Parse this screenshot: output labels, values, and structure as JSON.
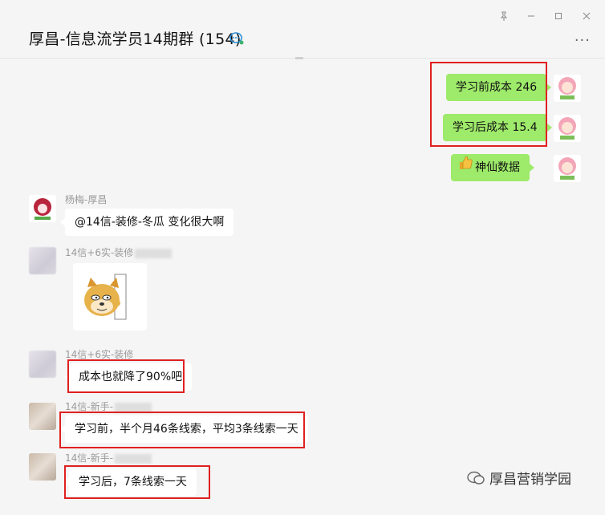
{
  "window": {
    "title": "厚昌-信息流学员14期群 (154)",
    "controls": [
      "pin-icon",
      "minimize-icon",
      "maximize-icon",
      "close-icon"
    ],
    "more_label": "···"
  },
  "messages": {
    "m1": {
      "text": "学习前成本 246",
      "sender": "self"
    },
    "m2": {
      "text": "学习后成本 15.4",
      "sender": "self"
    },
    "m3": {
      "text": "神仙数据",
      "emoji": "thumbs-up-icon",
      "sender": "self"
    },
    "m4": {
      "name": "杨梅-厚昌",
      "text": "@14信-装修-冬瓜 变化很大啊"
    },
    "m5": {
      "name": "14信+6实-装修",
      "sticker": "doge-peek-sticker"
    },
    "m6": {
      "name": "14信+6实-装修",
      "text": "成本也就降了90%吧"
    },
    "m7": {
      "name": "14信-新手-",
      "text": "学习前，半个月46条线索，平均3条线索一天"
    },
    "m8": {
      "name": "14信-新手-",
      "text": "学习后，7条线索一天"
    }
  },
  "watermark": {
    "text": "厚昌营销学园"
  },
  "colors": {
    "self_bubble": "#9eea6a",
    "other_bubble": "#ffffff",
    "highlight_box": "#e02020",
    "background": "#f5f5f5"
  }
}
